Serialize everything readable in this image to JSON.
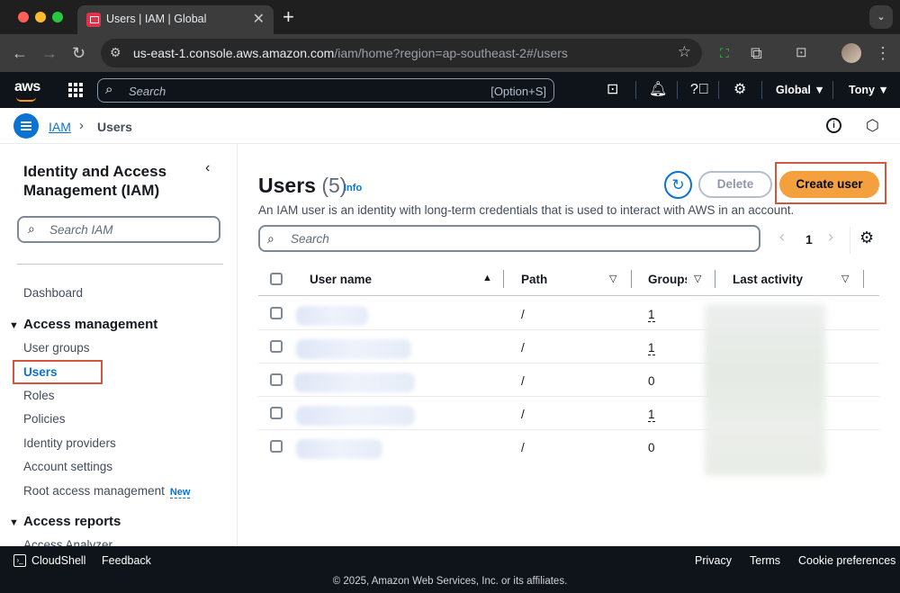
{
  "browser": {
    "tab_title": "Users | IAM | Global",
    "url_host": "us-east-1.console.aws.amazon.com",
    "url_path": "/iam/home?region=ap-southeast-2#/users",
    "icons": [
      "back-icon",
      "forward-icon",
      "reload-icon",
      "site-settings-icon",
      "star-icon",
      "extensions-icon",
      "more-icon"
    ]
  },
  "aws_nav": {
    "logo": "aws",
    "search_placeholder": "Search",
    "search_shortcut": "[Option+S]",
    "region": "Global ▼",
    "account": "Tony ▼"
  },
  "breadcrumb": {
    "root": "IAM",
    "current": "Users"
  },
  "sidebar": {
    "title": "Identity and Access Management (IAM)",
    "search_placeholder": "Search IAM",
    "dashboard": "Dashboard",
    "section_access_mgmt": "Access management",
    "items": [
      "User groups",
      "Users",
      "Roles",
      "Policies",
      "Identity providers",
      "Account settings",
      "Root access management"
    ],
    "new_badge": "New",
    "section_reports": "Access reports",
    "cut_item": "Access Analyzer"
  },
  "main": {
    "title": "Users",
    "count": "(5)",
    "info": "Info",
    "delete_label": "Delete",
    "create_label": "Create user",
    "description": "An IAM user is an identity with long-term credentials that is used to interact with AWS in an account.",
    "search_placeholder": "Search",
    "page": "1"
  },
  "table": {
    "headers": {
      "user_name": "User name",
      "path": "Path",
      "groups": "Groups",
      "last_activity": "Last activity"
    },
    "rows": [
      {
        "path": "/",
        "groups": "1"
      },
      {
        "path": "/",
        "groups": "1"
      },
      {
        "path": "/",
        "groups": "0"
      },
      {
        "path": "/",
        "groups": "1"
      },
      {
        "path": "/",
        "groups": "0"
      }
    ]
  },
  "footer": {
    "cloudshell": "CloudShell",
    "feedback": "Feedback",
    "privacy": "Privacy",
    "terms": "Terms",
    "cookies": "Cookie preferences",
    "copyright": "© 2025, Amazon Web Services, Inc. or its affiliates."
  },
  "colors": {
    "primary": "#0972d3",
    "create_button": "#f4a03f",
    "annotation_box": "#d1583e",
    "aws_nav_bg": "#0f141a"
  }
}
